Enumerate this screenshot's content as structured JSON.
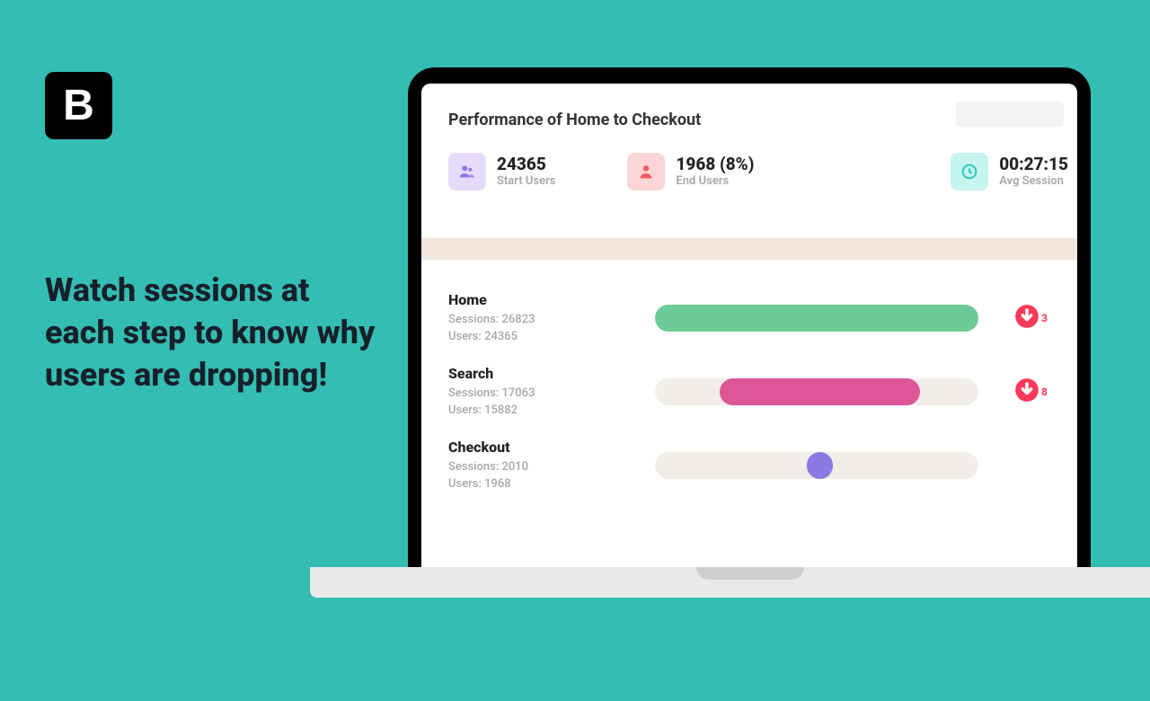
{
  "logo_letter": "B",
  "headline": "Watch sessions at each step to know why users are dropping!",
  "report": {
    "title": "Performance of Home to Checkout",
    "kpis": {
      "start": {
        "value": "24365",
        "label": "Start Users"
      },
      "end": {
        "value": "1968 (8%)",
        "label": "End Users"
      },
      "avg": {
        "value": "00:27:15",
        "label": "Avg Session"
      }
    },
    "steps": [
      {
        "name": "Home",
        "sessions_label": "Sessions: 26823",
        "users_label": "Users: 24365",
        "bar": {
          "color": "#6dcb97",
          "left_pct": 0,
          "width_pct": 100,
          "track_visible": false
        },
        "drop": "3"
      },
      {
        "name": "Search",
        "sessions_label": "Sessions: 17063",
        "users_label": "Users: 15882",
        "bar": {
          "color": "#dd5698",
          "left_pct": 20,
          "width_pct": 62,
          "track_visible": true
        },
        "drop": "8"
      },
      {
        "name": "Checkout",
        "sessions_label": "Sessions: 2010",
        "users_label": "Users: 1968",
        "bar": {
          "color": "#8b78e2",
          "left_pct": 47,
          "width_pct": 8,
          "track_visible": true
        },
        "drop": null
      }
    ]
  },
  "colors": {
    "page_bg": "#34bdb3",
    "accent_green": "#6dcb97",
    "accent_pink": "#dd5698",
    "accent_purple": "#8b78e2",
    "accent_red": "#fb3958"
  }
}
